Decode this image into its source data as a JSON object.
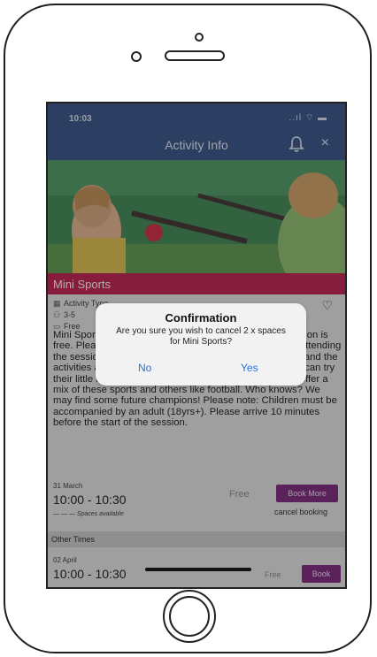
{
  "status_bar": {
    "time": "10:03",
    "indicators": "..ıl ⌔ ▬"
  },
  "nav": {
    "title": "Activity Info",
    "bell_icon": "bell-icon",
    "close_label": "×"
  },
  "banner": {
    "title": "Mini Sports"
  },
  "meta": {
    "activity_type": "Activity Type",
    "ages": "3-5",
    "price": "Free"
  },
  "description": "Mini Sports is a fun session for young children. This session is free. Please book for the number of children you will be attending the session with. Your little ones will love these sessions and the activities are planned especially with them in mind. They can try their little hands at archery or fencing! Some parks also offer a mix of these sports and others like football. Who knows? We may find some future champions! Please note: Children must be accompanied by an adult (18yrs+). Please arrive 10 minutes before the start of the session.",
  "booking": {
    "date": "31 March",
    "time": "10:00 - 10:30",
    "spaces": "— — — Spaces available",
    "price": "Free",
    "book_label": "Book More",
    "cancel_label": "cancel booking"
  },
  "other_times": {
    "heading": "Other Times",
    "date": "02 April",
    "time": "10:00 - 10:30",
    "price": "Free",
    "book_label": "Book"
  },
  "dialog": {
    "title": "Confirmation",
    "message": "Are you sure you wish to cancel 2 x spaces for Mini Sports?",
    "no_label": "No",
    "yes_label": "Yes"
  },
  "colors": {
    "nav": "#2f4e86",
    "banner": "#c2174a",
    "book": "#7a1e7a",
    "link": "#2a72d6"
  }
}
